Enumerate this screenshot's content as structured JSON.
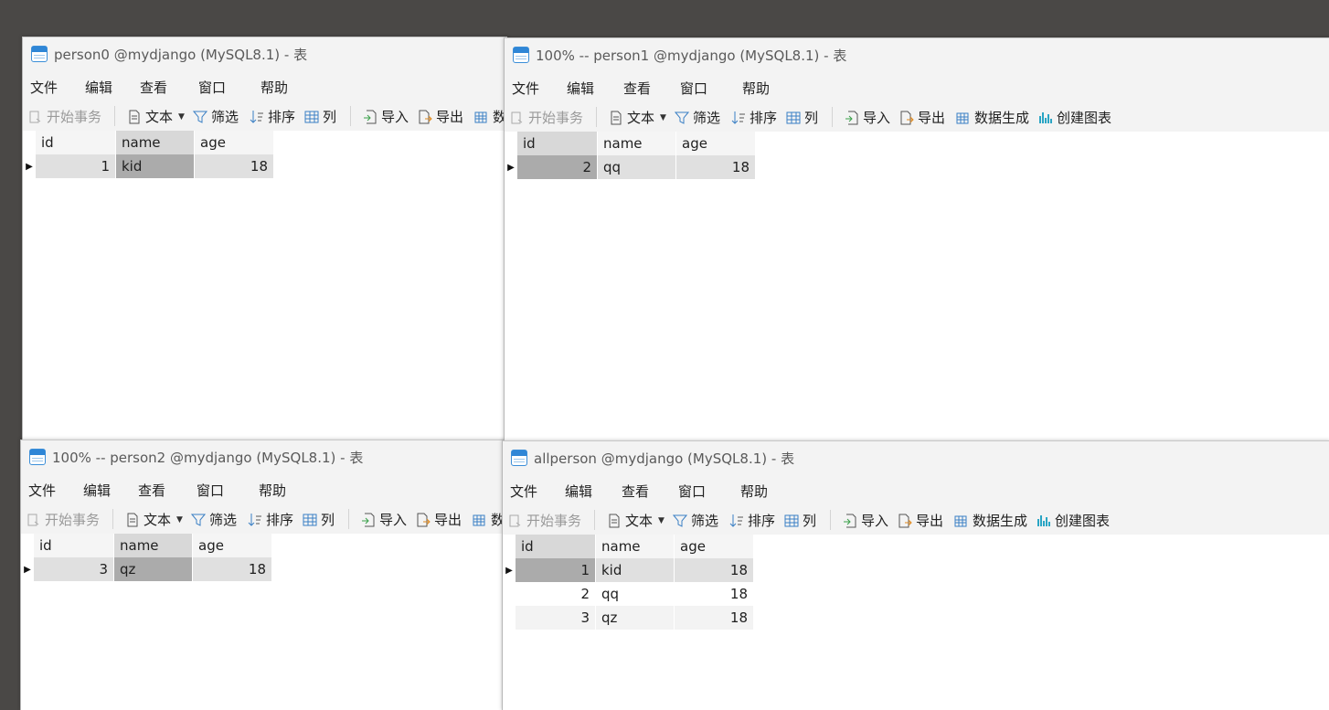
{
  "menu": {
    "file": "文件",
    "edit": "编辑",
    "view": "查看",
    "window": "窗口",
    "help": "帮助"
  },
  "toolbar": {
    "begin_transaction": "开始事务",
    "text": "文本",
    "filter": "筛选",
    "sort": "排序",
    "columns": "列",
    "import": "导入",
    "export": "导出",
    "data_generation": "数据生成",
    "data_generation_clipped": "数",
    "create_chart": "创建图表"
  },
  "columns": {
    "id": "id",
    "name": "name",
    "age": "age"
  },
  "windows": {
    "w0": {
      "title": "person0 @mydjango (MySQL8.1) - 表",
      "rows": [
        {
          "id": "1",
          "name": "kid",
          "age": "18"
        }
      ]
    },
    "w1": {
      "title": "100% -- person1 @mydjango (MySQL8.1) - 表",
      "rows": [
        {
          "id": "2",
          "name": "qq",
          "age": "18"
        }
      ]
    },
    "w2": {
      "title": "100% -- person2 @mydjango (MySQL8.1) - 表",
      "rows": [
        {
          "id": "3",
          "name": "qz",
          "age": "18"
        }
      ]
    },
    "w3": {
      "title": "allperson @mydjango (MySQL8.1) - 表",
      "rows": [
        {
          "id": "1",
          "name": "kid",
          "age": "18"
        },
        {
          "id": "2",
          "name": "qq",
          "age": "18"
        },
        {
          "id": "3",
          "name": "qz",
          "age": "18"
        }
      ]
    }
  }
}
